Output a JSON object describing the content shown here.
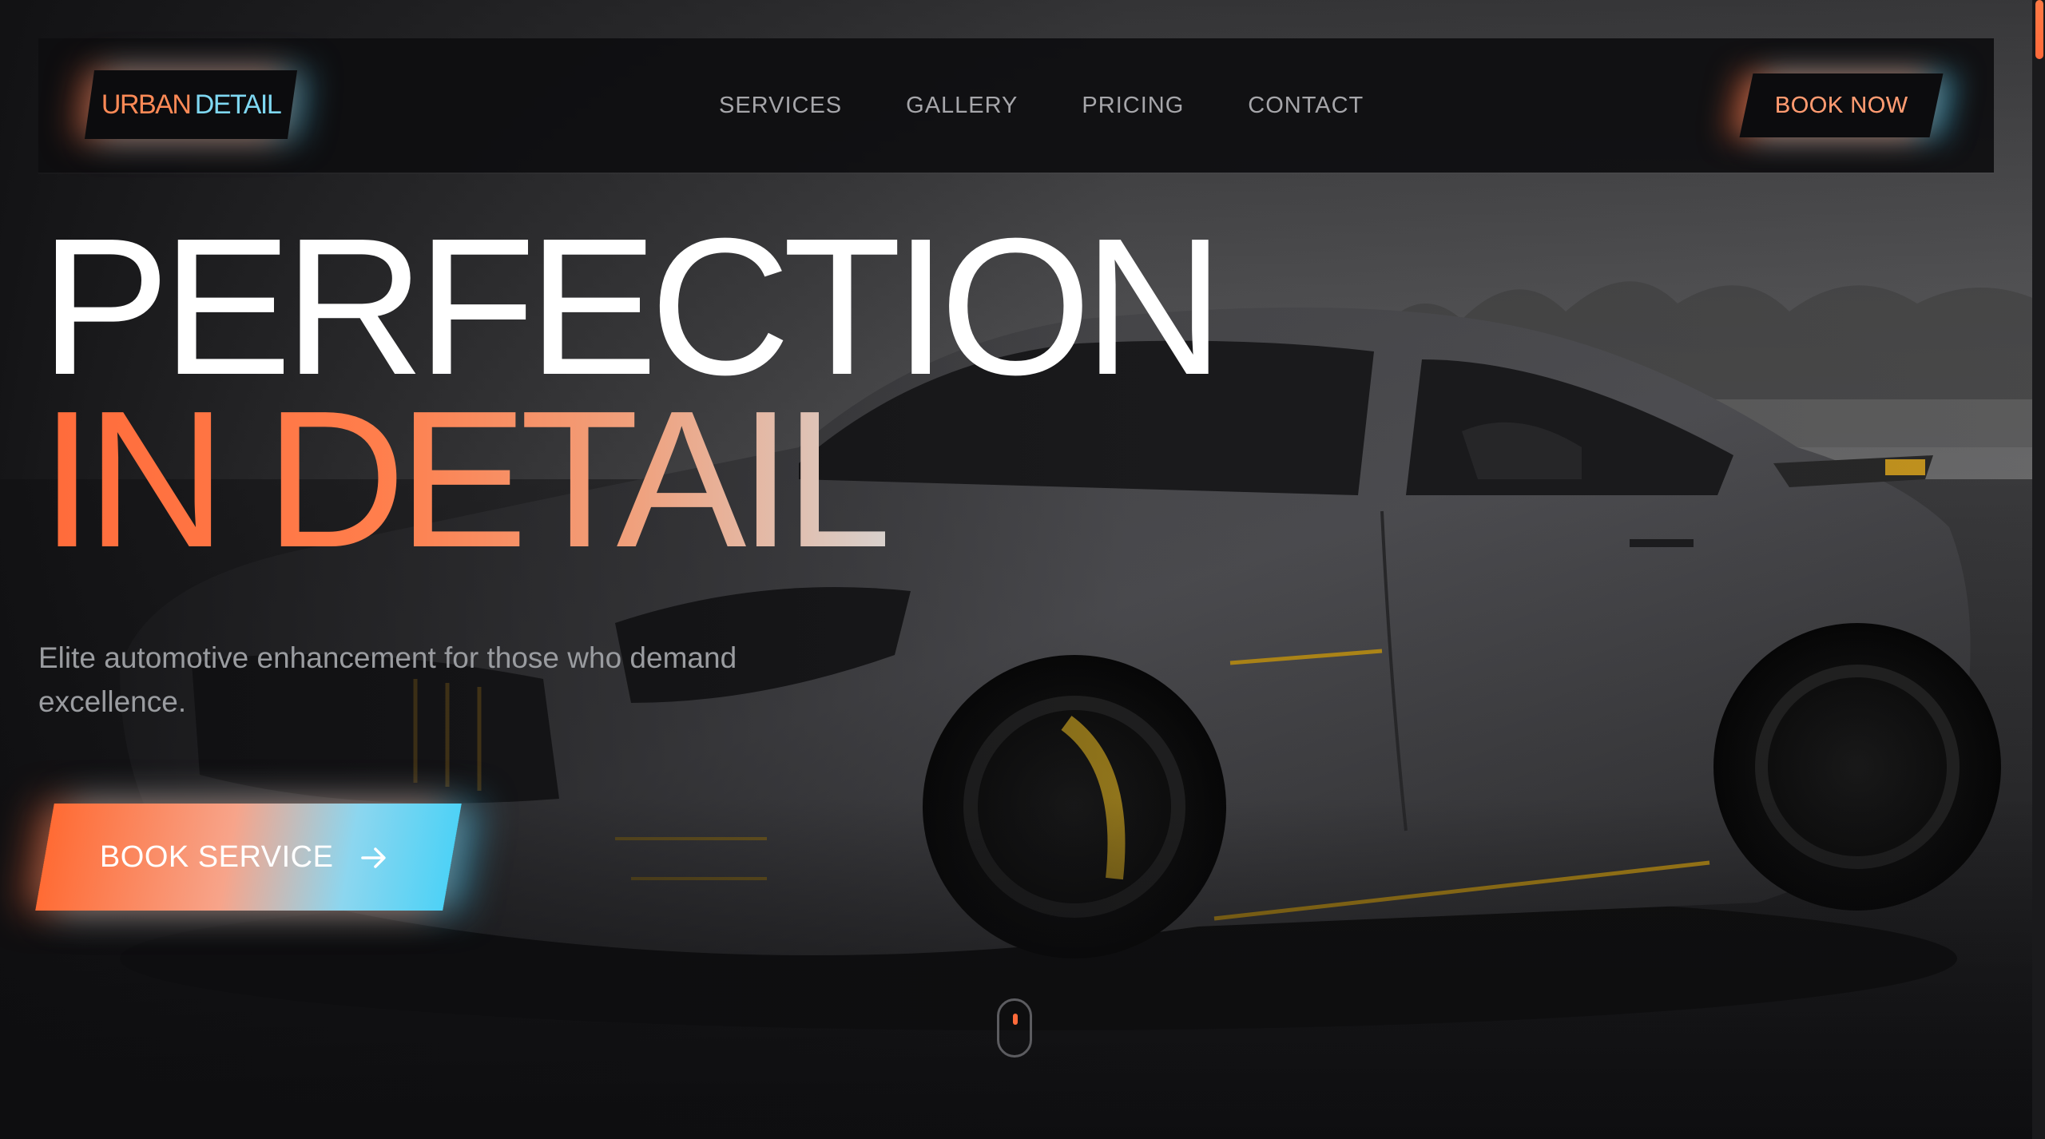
{
  "brand": {
    "name_part1": "URBAN",
    "name_part2": "DETAIL"
  },
  "nav": {
    "links": [
      {
        "label": "SERVICES"
      },
      {
        "label": "GALLERY"
      },
      {
        "label": "PRICING"
      },
      {
        "label": "CONTACT"
      }
    ],
    "cta_label": "BOOK NOW"
  },
  "hero": {
    "headline_line1": "PERFECTION",
    "headline_line2": "IN DETAIL",
    "subtitle": "Elite automotive enhancement for those who demand excellence.",
    "cta_label": "BOOK SERVICE",
    "cta_icon": "arrow-right-icon",
    "background_image": "dark grey sports car on track"
  },
  "scroll_indicator": {
    "icon": "mouse-scroll-icon"
  },
  "colors": {
    "accent_orange": "#ff6b3a",
    "accent_cyan": "#4ed2f6",
    "background": "#0e0e10",
    "nav_text": "#a6a6aa"
  }
}
